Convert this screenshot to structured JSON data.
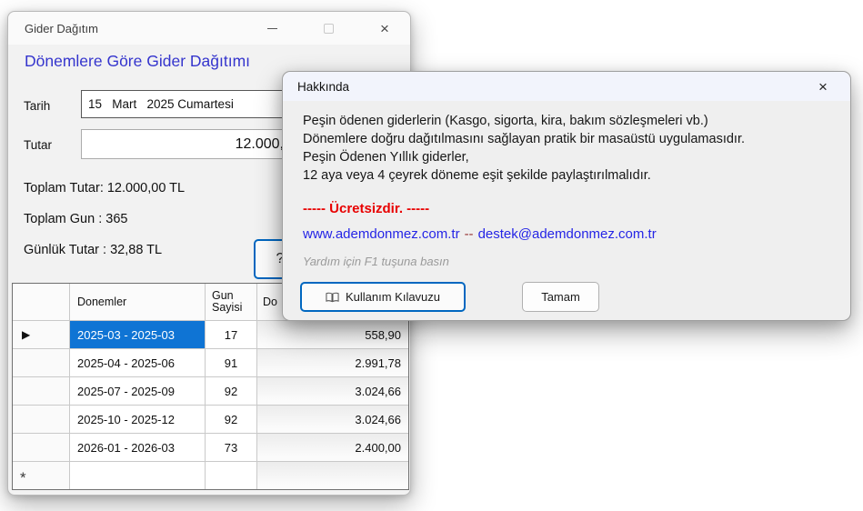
{
  "colors": {
    "heading_blue": "#3535cd",
    "selection_blue": "#0f74d4",
    "free_red": "#e80000",
    "link_blue": "#2525e6",
    "focus_border_blue": "#0067c0"
  },
  "icons": {
    "close": "×",
    "current_row_marker": "▶",
    "new_row_marker": "*"
  },
  "main_window": {
    "title": "Gider Dağıtım",
    "heading": "Dönemlere Göre Gider Dağıtımı",
    "date_label": "Tarih",
    "date_value": "15   Mart   2025 Cumartesi",
    "amount_label": "Tutar",
    "amount_value": "12.000,",
    "stats": {
      "total_amount": "Toplam Tutar: 12.000,00 TL",
      "total_days": "Toplam Gun : 365",
      "daily_amount": "Günlük Tutar : 32,88 TL"
    },
    "help_button_label": "?"
  },
  "grid": {
    "header": {
      "periods": "Donemler",
      "days_line1": "Gun",
      "days_line2": "Sayisi",
      "amount": "Do"
    },
    "rows": [
      {
        "period": "2025-03 - 2025-03",
        "days": "17",
        "amount": "558,90"
      },
      {
        "period": "2025-04 - 2025-06",
        "days": "91",
        "amount": "2.991,78"
      },
      {
        "period": "2025-07 - 2025-09",
        "days": "92",
        "amount": "3.024,66"
      },
      {
        "period": "2025-10 - 2025-12",
        "days": "92",
        "amount": "3.024,66"
      },
      {
        "period": "2026-01 - 2026-03",
        "days": "73",
        "amount": "2.400,00"
      }
    ]
  },
  "about_dialog": {
    "title": "Hakkında",
    "body_lines": [
      "Peşin ödenen giderlerin (Kasgo, sigorta, kira, bakım sözleşmeleri vb.)",
      "Dönemlere doğru dağıtılmasını sağlayan pratik bir masaüstü uygulamasıdır.",
      "Peşin Ödenen Yıllık giderler,",
      "12 aya veya 4 çeyrek döneme eşit şekilde paylaştırılmalıdır."
    ],
    "free_text": "----- Ücretsizdir. -----",
    "link_left": "www.ademdonmez.com.tr",
    "link_separator": "--",
    "link_right": "destek@ademdonmez.com.tr",
    "hint": "Yardım için F1 tuşuna basın",
    "manual_button": "Kullanım Kılavuzu",
    "ok_button": "Tamam"
  }
}
